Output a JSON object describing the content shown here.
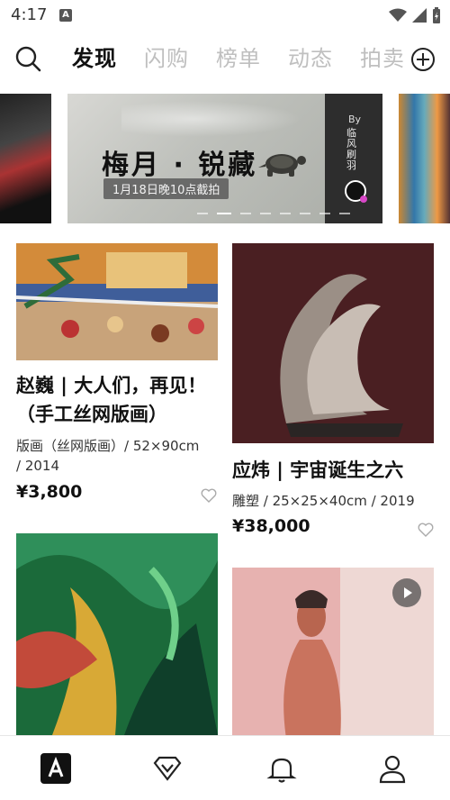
{
  "status_bar": {
    "time": "4:17",
    "app_icon_letter": "A"
  },
  "top_nav": {
    "tabs": [
      {
        "label": "发现",
        "active": true
      },
      {
        "label": "闪购",
        "active": false
      },
      {
        "label": "榜单",
        "active": false
      },
      {
        "label": "动态",
        "active": false
      },
      {
        "label": "拍卖",
        "active": false
      }
    ]
  },
  "banner": {
    "title": "梅月 · 锐藏",
    "subtitle": "1月18日晚10点截拍",
    "by_label": "By",
    "author": "临风刷羽",
    "active_slide": 2,
    "slide_count": 9
  },
  "artworks": [
    {
      "title": "赵巍 | 大人们，再见！（手工丝网版画）",
      "meta": "版画（丝网版画）/ 52×90cm / 2014",
      "price": "¥3,800"
    },
    {
      "title": "应炜 | 宇宙诞生之六",
      "meta": "雕塑 / 25×25×40cm / 2019",
      "price": "¥38,000"
    }
  ],
  "bottom_nav": {
    "items": [
      "home",
      "discover",
      "notifications",
      "profile"
    ]
  },
  "colors": {
    "accent": "#111111",
    "inactive_tab": "#bfbfbf",
    "badge": "#d847c7"
  }
}
